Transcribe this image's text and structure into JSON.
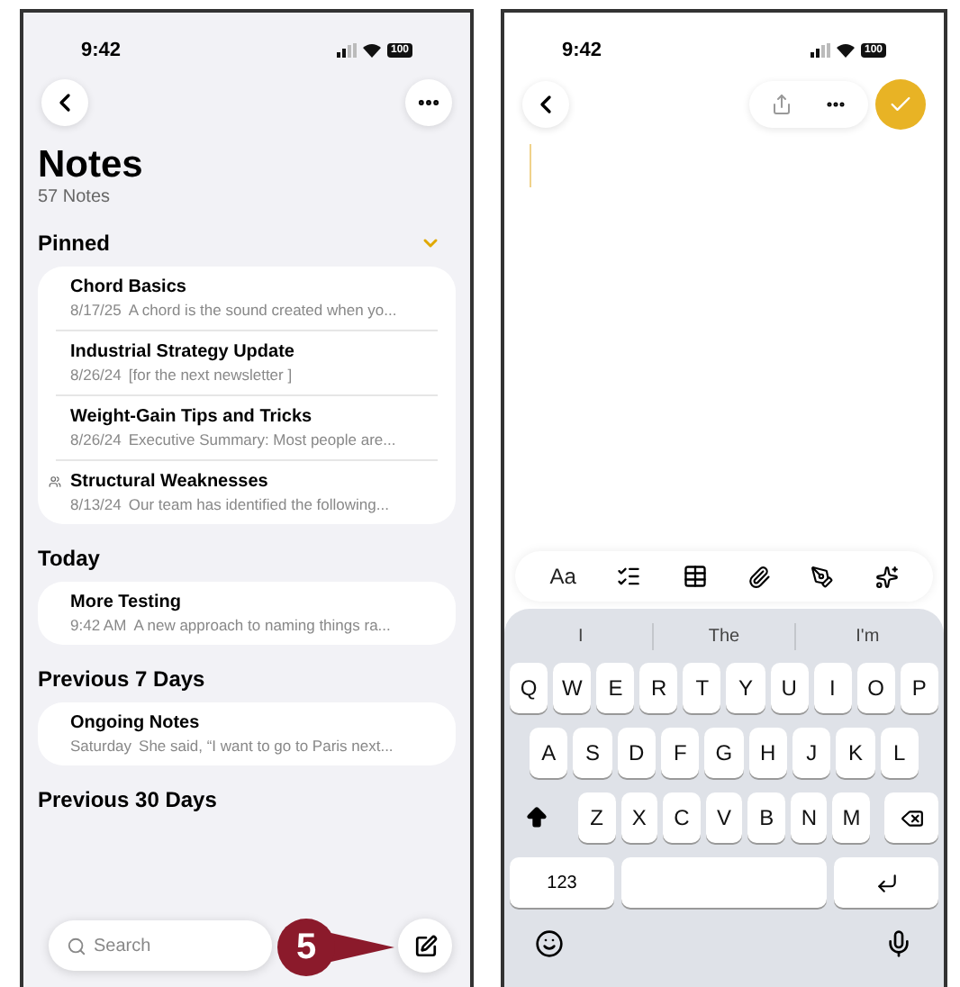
{
  "list_screen": {
    "status_time": "9:42",
    "battery": "100",
    "title": "Notes",
    "count": "57 Notes",
    "sections": [
      {
        "heading": "Pinned",
        "expanded": true,
        "notes": [
          {
            "title": "Chord Basics",
            "date": "8/17/25",
            "preview": "A chord is the sound created when yo...",
            "shared": false
          },
          {
            "title": "Industrial Strategy Update",
            "date": "8/26/24",
            "preview": "[for the next newsletter ]",
            "shared": false
          },
          {
            "title": "Weight-Gain Tips and Tricks",
            "date": "8/26/24",
            "preview": "Executive Summary: Most people are...",
            "shared": false
          },
          {
            "title": "Structural Weaknesses",
            "date": "8/13/24",
            "preview": "Our team has identified the following...",
            "shared": true
          }
        ]
      },
      {
        "heading": "Today",
        "notes": [
          {
            "title": "More Testing",
            "date": "9:42 AM",
            "preview": "A new approach to naming things ra...",
            "shared": false
          }
        ]
      },
      {
        "heading": "Previous 7 Days",
        "notes": [
          {
            "title": "Ongoing Notes",
            "date": "Saturday",
            "preview": "She said, “I want to go to Paris next...",
            "shared": false
          }
        ]
      },
      {
        "heading": "Previous 30 Days"
      }
    ],
    "search": {
      "placeholder": "Search"
    },
    "callout": "5"
  },
  "editor_screen": {
    "status_time": "9:42",
    "battery": "100",
    "format_label": "Aa",
    "suggestions": [
      "I",
      "The",
      "I'm"
    ],
    "key_rows": [
      [
        "Q",
        "W",
        "E",
        "R",
        "T",
        "Y",
        "U",
        "I",
        "O",
        "P"
      ],
      [
        "A",
        "S",
        "D",
        "F",
        "G",
        "H",
        "J",
        "K",
        "L"
      ],
      [
        "Z",
        "X",
        "C",
        "V",
        "B",
        "N",
        "M"
      ]
    ],
    "numbers_key": "123"
  }
}
